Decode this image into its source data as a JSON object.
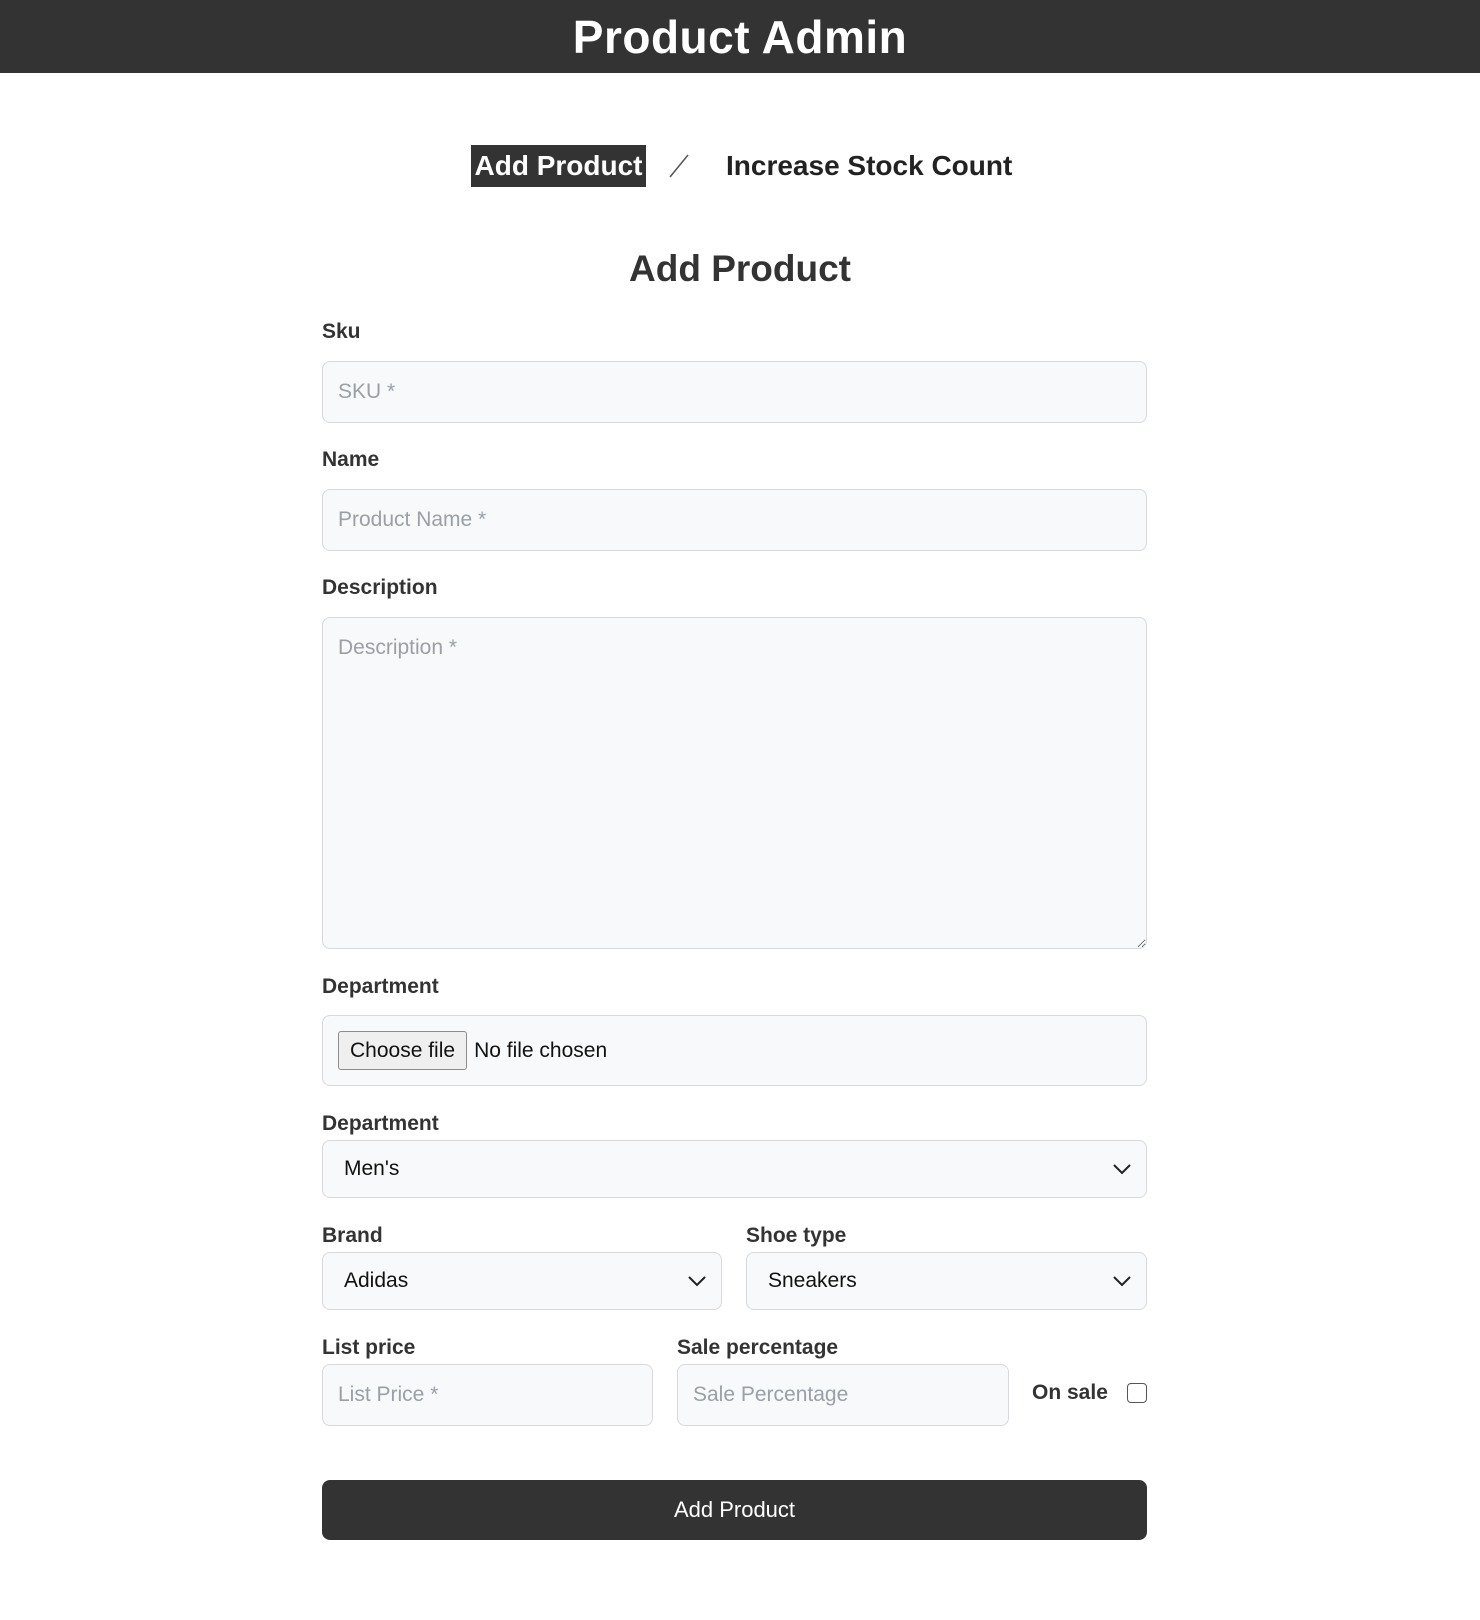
{
  "header": {
    "title": "Product Admin"
  },
  "tabs": [
    {
      "label": "Add Product",
      "active": true
    },
    {
      "label": "Increase Stock Count",
      "active": false
    }
  ],
  "form": {
    "title": "Add Product",
    "sku": {
      "label": "Sku",
      "placeholder": "SKU *",
      "value": ""
    },
    "name": {
      "label": "Name",
      "placeholder": "Product Name *",
      "value": ""
    },
    "description": {
      "label": "Description",
      "placeholder": "Description *",
      "value": ""
    },
    "image": {
      "label": "Department",
      "button_label": "Choose file",
      "status": "No file chosen"
    },
    "department": {
      "label": "Department",
      "selected": "Men's"
    },
    "brand": {
      "label": "Brand",
      "selected": "Adidas"
    },
    "shoe_type": {
      "label": "Shoe type",
      "selected": "Sneakers"
    },
    "list_price": {
      "label": "List price",
      "placeholder": "List Price *",
      "value": ""
    },
    "sale_percentage": {
      "label": "Sale percentage",
      "placeholder": "Sale Percentage",
      "value": ""
    },
    "on_sale": {
      "label": "On sale",
      "checked": false
    },
    "submit_label": "Add Product"
  },
  "icons": {
    "tab_separator": "slash-divider-icon",
    "select_arrow": "chevron-down-icon",
    "resize_handle": "resize-grip-icon"
  },
  "colors": {
    "header_bg": "#333333",
    "active_tab_bg": "#333333",
    "button_bg": "#333333",
    "input_bg": "#f8f9fa",
    "input_border": "#d7d9dc"
  }
}
